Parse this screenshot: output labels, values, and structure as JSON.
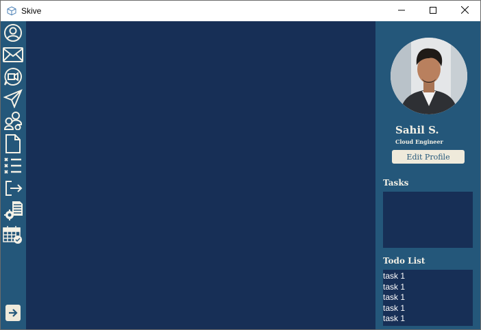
{
  "window": {
    "title": "Skive",
    "controls": [
      "minimize-icon",
      "maximize-icon",
      "close-icon"
    ]
  },
  "sidebar": {
    "items": [
      {
        "icon": "profile-icon"
      },
      {
        "icon": "mail-icon"
      },
      {
        "icon": "video-chat-icon"
      },
      {
        "icon": "send-icon"
      },
      {
        "icon": "team-icon"
      },
      {
        "icon": "document-icon"
      },
      {
        "icon": "task-list-icon"
      },
      {
        "icon": "logout-icon"
      },
      {
        "icon": "settings-document-icon"
      },
      {
        "icon": "calendar-check-icon"
      }
    ],
    "bottom_item": {
      "icon": "collapse-arrow-icon"
    }
  },
  "profile": {
    "name": "Sahil S.",
    "role": "Cloud Engineer",
    "edit_label": "Edit Profile"
  },
  "tasks": {
    "title": "Tasks",
    "items": []
  },
  "todo": {
    "title": "Todo List",
    "items": [
      "task 1",
      "task 1",
      "task 1",
      "task 1",
      "task 1"
    ]
  },
  "colors": {
    "sidebar": "#24577a",
    "main": "#172f56",
    "text_light": "#f4f1e6",
    "button": "#efeadb"
  }
}
